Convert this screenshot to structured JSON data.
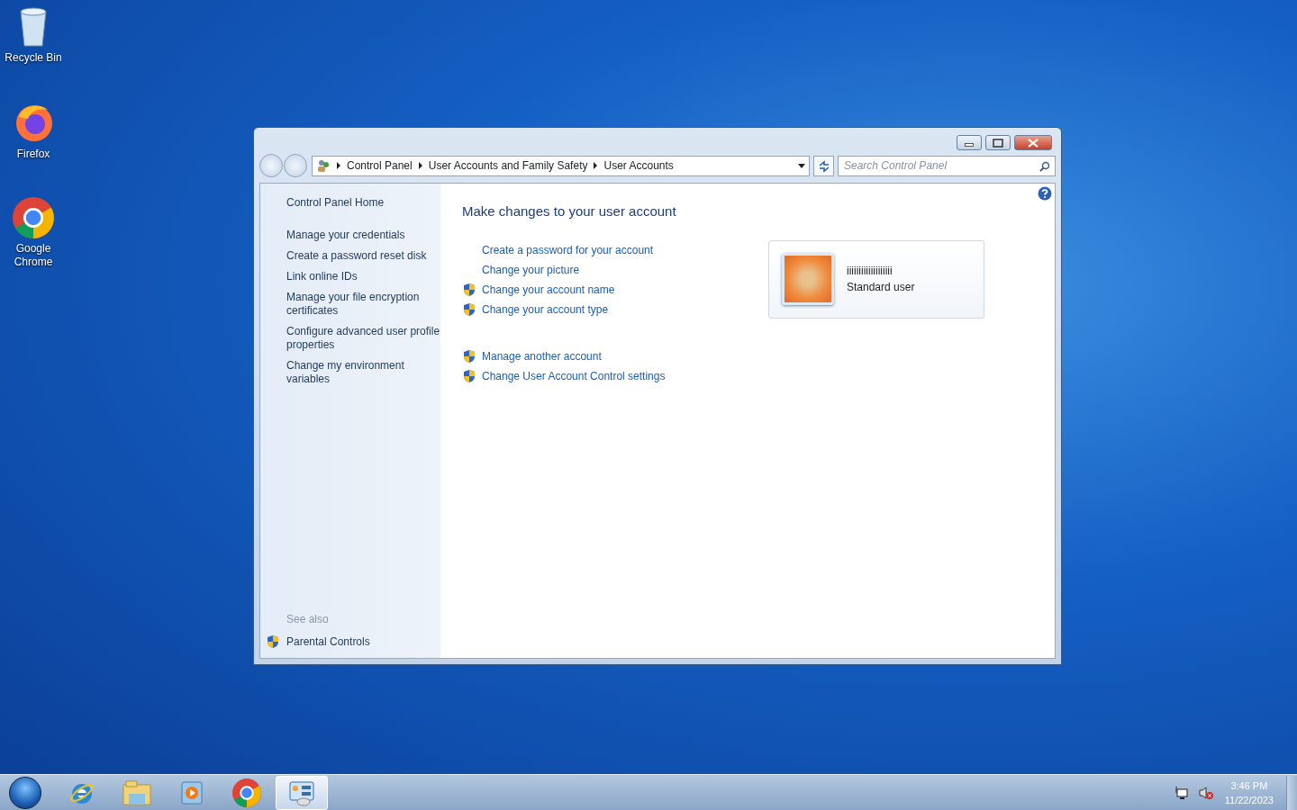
{
  "desktop_icons": [
    {
      "kind": "recycle",
      "label": "Recycle Bin"
    },
    {
      "kind": "firefox",
      "label": "Firefox"
    },
    {
      "kind": "chrome",
      "label": "Google Chrome"
    }
  ],
  "window": {
    "breadcrumb": [
      "Control Panel",
      "User Accounts and Family Safety",
      "User Accounts"
    ],
    "search": {
      "placeholder": "Search Control Panel"
    }
  },
  "sidebar": {
    "items": [
      "Control Panel Home",
      "Manage your credentials",
      "Create a password reset disk",
      "Link online IDs",
      "Manage your file encryption certificates",
      "Configure advanced user profile properties",
      "Change my environment variables"
    ],
    "see_also": {
      "heading": "See also",
      "items": [
        {
          "label": "Parental Controls",
          "shield": true
        }
      ]
    }
  },
  "main": {
    "title": "Make changes to your user account",
    "link_groups": [
      [
        {
          "label": "Create a password for your account",
          "shield": false
        },
        {
          "label": "Change your picture",
          "shield": false
        },
        {
          "label": "Change your account name",
          "shield": true
        },
        {
          "label": "Change your account type",
          "shield": true
        }
      ],
      [
        {
          "label": "Manage another account",
          "shield": true
        },
        {
          "label": "Change User Account Control settings",
          "shield": true
        }
      ]
    ]
  },
  "account": {
    "name": "iiiiiiiiiiiiiiiiiii",
    "type": "Standard user"
  },
  "taskbar": {
    "items": [
      {
        "kind": "ie",
        "active": false
      },
      {
        "kind": "explorer",
        "active": false
      },
      {
        "kind": "media",
        "active": false
      },
      {
        "kind": "chrome",
        "active": false
      },
      {
        "kind": "control",
        "active": true
      }
    ]
  },
  "clock": {
    "time": "3:46 PM",
    "date": "11/22/2023"
  }
}
